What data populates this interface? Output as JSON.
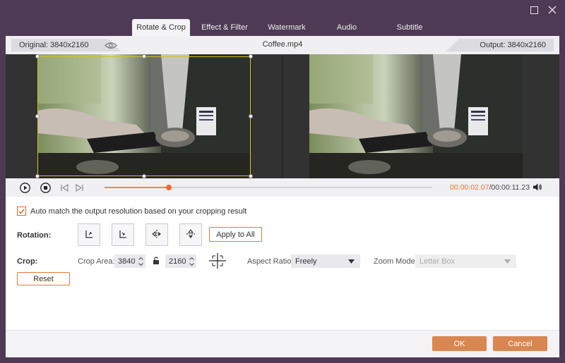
{
  "window": {
    "maximize_icon": "maximize-icon",
    "close_icon": "close-icon"
  },
  "tabs": [
    {
      "label": "Rotate & Crop",
      "active": true
    },
    {
      "label": "Effect & Filter",
      "active": false
    },
    {
      "label": "Watermark",
      "active": false
    },
    {
      "label": "Audio",
      "active": false
    },
    {
      "label": "Subtitle",
      "active": false
    }
  ],
  "file": {
    "original_label": "Original: 3840x2160",
    "name": "Coffee.mp4",
    "output_label": "Output: 3840x2160"
  },
  "playback": {
    "current_time": "00:00:02.07",
    "separator": "/",
    "total_time": "00:00:11.23",
    "progress": 0.197
  },
  "options": {
    "auto_match_checked": true,
    "auto_match_label": "Auto match the output resolution based on your cropping result"
  },
  "rotation": {
    "label": "Rotation:",
    "apply_all_label": "Apply to All"
  },
  "crop": {
    "label": "Crop:",
    "area_label": "Crop Area:",
    "width": "3840",
    "height": "2160",
    "aspect_label": "Aspect Ratio:",
    "aspect_value": "Freely",
    "zoom_label": "Zoom Mode:",
    "zoom_value": "Letter Box",
    "reset_label": "Reset"
  },
  "footer": {
    "ok_label": "OK",
    "cancel_label": "Cancel"
  },
  "colors": {
    "accent": "#e8742e",
    "button_fill": "#d98752",
    "background": "#4e3a55",
    "crop_frame": "#d4c21a"
  }
}
